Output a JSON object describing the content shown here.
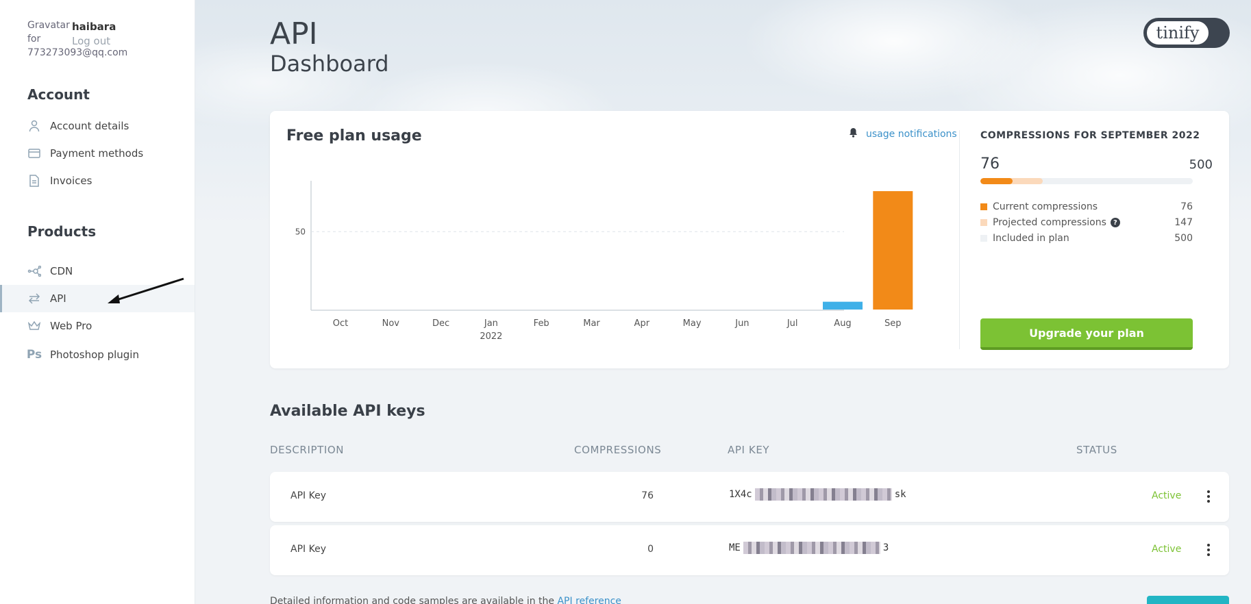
{
  "user": {
    "gravatar_alt_line1": "Gravatar",
    "gravatar_alt_line2": "for",
    "gravatar_alt_email": "773273093@qq.com",
    "name": "haibara",
    "logout": "Log out"
  },
  "sidebar": {
    "account_heading": "Account",
    "account_items": [
      {
        "label": "Account details",
        "icon": "user-icon"
      },
      {
        "label": "Payment methods",
        "icon": "credit-card-icon"
      },
      {
        "label": "Invoices",
        "icon": "document-icon"
      }
    ],
    "products_heading": "Products",
    "product_items": [
      {
        "label": "CDN",
        "icon": "network-icon"
      },
      {
        "label": "API",
        "icon": "arrows-exchange-icon",
        "active": true
      },
      {
        "label": "Web Pro",
        "icon": "crown-icon"
      },
      {
        "label": "Photoshop plugin",
        "icon": "photoshop-icon"
      }
    ]
  },
  "header": {
    "title": "API",
    "subtitle": "Dashboard",
    "logo_text": "tinify"
  },
  "usage": {
    "title": "Free plan usage",
    "notifications_link": "usage notifications",
    "compressions_heading": "COMPRESSIONS FOR SEPTEMBER 2022",
    "current": "76",
    "limit": "500",
    "current_fraction": 0.152,
    "projected_fraction": 0.294,
    "legend": [
      {
        "label": "Current compressions",
        "value": "76",
        "color": "#f28a18"
      },
      {
        "label": "Projected compressions",
        "value": "147",
        "color": "#fbd9bb",
        "help": "?"
      },
      {
        "label": "Included in plan",
        "value": "500",
        "color": "#eef1f4"
      }
    ],
    "upgrade_button": "Upgrade your plan"
  },
  "chart_data": {
    "type": "bar",
    "categories": [
      "Oct",
      "Nov",
      "Dec",
      "Jan",
      "Feb",
      "Mar",
      "Apr",
      "May",
      "Jun",
      "Jul",
      "Aug",
      "Sep"
    ],
    "year_label": "2022",
    "values": [
      0,
      0,
      0,
      0,
      0,
      0,
      0,
      0,
      0,
      0,
      5,
      76
    ],
    "colors": {
      "past": "#3fb0e8",
      "current": "#f28a18"
    },
    "yticks": [
      50
    ],
    "ylim": [
      0,
      80
    ],
    "grid": "dashed at 50"
  },
  "keys": {
    "title": "Available API keys",
    "columns": {
      "description": "DESCRIPTION",
      "compressions": "COMPRESSIONS",
      "api_key": "API KEY",
      "status": "STATUS"
    },
    "rows": [
      {
        "description": "API Key",
        "compressions": "76",
        "key_start": "1X4c",
        "key_end": "sk",
        "status": "Active"
      },
      {
        "description": "API Key",
        "compressions": "0",
        "key_start": "ME",
        "key_end": "3",
        "status": "Active"
      }
    ]
  },
  "footer": {
    "text": "Detailed information and code samples are available in the",
    "link": "API reference"
  }
}
